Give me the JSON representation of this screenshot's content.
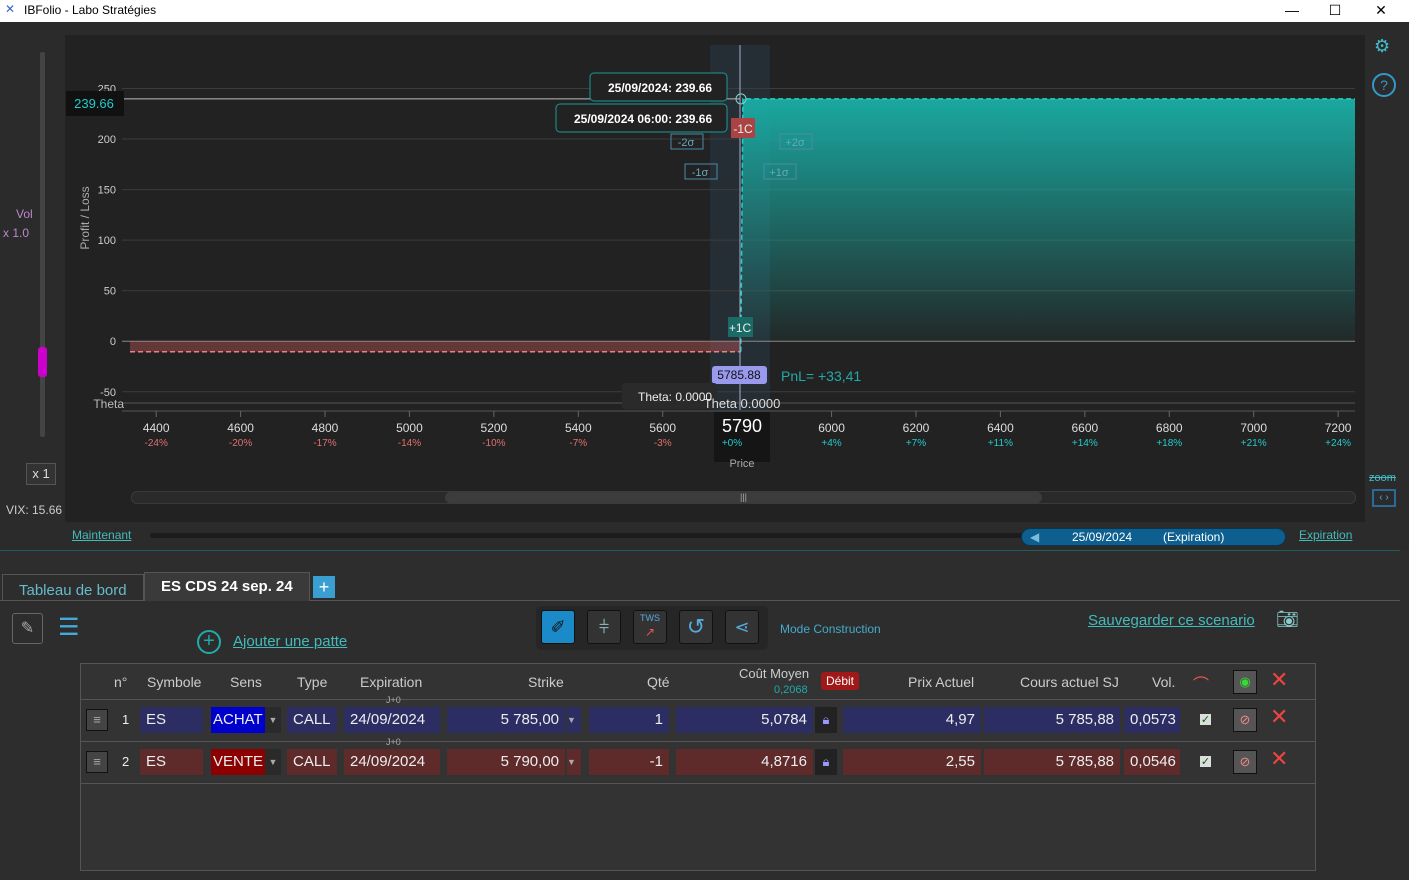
{
  "window": {
    "title": "IBFolio - Labo Stratégies",
    "minimize": "—",
    "maximize": "☐",
    "close": "✕"
  },
  "left_panel": {
    "vol_label": "Vol",
    "vol_mult": "x 1.0",
    "mult_button": "x 1",
    "vix": "VIX: 15.66"
  },
  "chart_data": {
    "type": "line",
    "ylabel": "Profit / Loss",
    "xlabel": "Price",
    "xlim": [
      4338,
      7240
    ],
    "ylim": [
      -68,
      293
    ],
    "x_ticks": [
      4400,
      4600,
      4800,
      5000,
      5200,
      5400,
      5600,
      5800,
      6000,
      6200,
      6400,
      6600,
      6800,
      7000,
      7200
    ],
    "x_tick_labels": [
      "4400",
      "4600",
      "4800",
      "5000",
      "5200",
      "5400",
      "5600",
      "5790",
      "6000",
      "6200",
      "6400",
      "6600",
      "6800",
      "7000",
      "7200"
    ],
    "x_pct_labels": [
      "-24%",
      "-20%",
      "-17%",
      "-14%",
      "-10%",
      "-7%",
      "-3%",
      "+0%",
      "+4%",
      "+7%",
      "+11%",
      "+14%",
      "+18%",
      "+21%",
      "+24%"
    ],
    "y_ticks": [
      -50,
      0,
      50,
      100,
      150,
      200,
      250
    ],
    "series": [
      {
        "name": "Expiration 25/09/2024",
        "x": [
          4338,
          5785,
          5790,
          7240
        ],
        "y": [
          -10.34,
          -10.34,
          239.66,
          239.66
        ]
      }
    ],
    "current_value_label": "239.66",
    "tooltips": [
      "25/09/2024: 239.66",
      "25/09/2024 06:00: 239.66"
    ],
    "markers": {
      "short": "-1C",
      "long": "+1C",
      "sigma": [
        "-2σ",
        "+2σ",
        "-1σ",
        "+1σ"
      ]
    },
    "underlying_label": "5785.88",
    "pnl_label": "PnL= +33,41",
    "theta_axis": "Theta",
    "theta_tooltip": "Theta: 0.0000",
    "theta_value": "Theta 0.0000",
    "cursor_price": "5790",
    "cursor_pct": "+0%"
  },
  "timeline": {
    "now_link": "Maintenant",
    "date": "25/09/2024",
    "date_note": "(Expiration)",
    "expiration_link": "Expiration",
    "zoom_label": "zoom"
  },
  "tabs": [
    {
      "label": "Tableau de bord"
    },
    {
      "label": "ES CDS 24 sep. 24"
    }
  ],
  "add_tab": "+",
  "toolbar": {
    "add_leg": "Ajouter une patte",
    "mode": "Mode Construction",
    "save": "Sauvegarder ce scenario",
    "tws": "TWS"
  },
  "table": {
    "headers": {
      "n": "n°",
      "symbol": "Symbole",
      "side": "Sens",
      "type": "Type",
      "expiration": "Expiration",
      "strike": "Strike",
      "qty": "Qté",
      "avg_cost": "Coût Moyen",
      "avg_cost_sub": "0,2068",
      "debit": "Débit",
      "price": "Prix Actuel",
      "underlying": "Cours actuel SJ",
      "vol": "Vol."
    },
    "rows": [
      {
        "n": "1",
        "symbol": "ES",
        "side": "ACHAT",
        "type": "CALL",
        "dte": "J+0",
        "expiration": "24/09/2024",
        "strike": "5 785,00",
        "qty": "1",
        "avg_cost": "5,0784",
        "price": "4,97",
        "underlying": "5 785,88",
        "vol": "0,0573"
      },
      {
        "n": "2",
        "symbol": "ES",
        "side": "VENTE",
        "type": "CALL",
        "dte": "J+0",
        "expiration": "24/09/2024",
        "strike": "5 790,00",
        "qty": "-1",
        "avg_cost": "4,8716",
        "price": "2,55",
        "underlying": "5 785,88",
        "vol": "0,0546"
      }
    ]
  },
  "colors": {
    "profit": "#1aa8a0",
    "loss": "#e06060",
    "buy": "#0000cc",
    "sell": "#8b0000"
  }
}
